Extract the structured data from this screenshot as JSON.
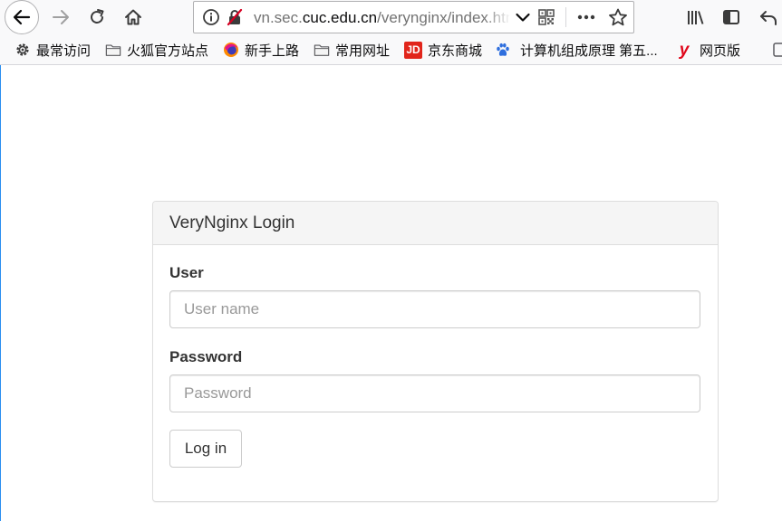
{
  "browser": {
    "url_prefix": "vn.sec.",
    "url_domain": "cuc.edu.cn",
    "url_path": "/verynginx/index.html"
  },
  "bookmarks": [
    {
      "label": "最常访问",
      "icon": "gear-icon"
    },
    {
      "label": "火狐官方站点",
      "icon": "folder-icon"
    },
    {
      "label": "新手上路",
      "icon": "firefox-icon"
    },
    {
      "label": "常用网址",
      "icon": "folder-icon"
    },
    {
      "label": "京东商城",
      "icon": "jd-icon",
      "icon_text": "JD"
    },
    {
      "label": "计算机组成原理 第五...",
      "icon": "paw-icon"
    },
    {
      "label": "网页版",
      "icon": "youdao-icon",
      "icon_text": "y"
    }
  ],
  "login": {
    "title": "VeryNginx Login",
    "user_label": "User",
    "user_placeholder": "User name",
    "password_label": "Password",
    "password_placeholder": "Password",
    "submit_label": "Log in"
  },
  "colors": {
    "panel_heading_bg": "#f5f5f5",
    "border": "#dddddd",
    "jd_red": "#e1251b",
    "youdao_red": "#e0081c",
    "baidu_blue": "#2f6fde"
  }
}
